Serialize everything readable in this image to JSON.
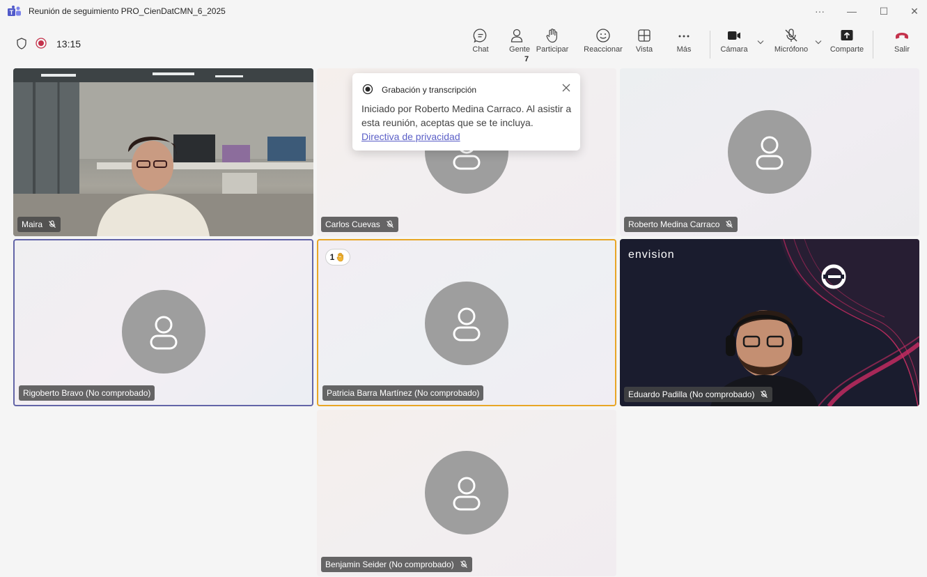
{
  "window": {
    "title": "Reunión de seguimiento PRO_CienDatCMN_6_2025",
    "more": "···",
    "minimize": "—",
    "maximize": "☐",
    "close": "✕"
  },
  "meeting": {
    "timer": "13:15"
  },
  "toolbar": {
    "chat": "Chat",
    "people": "Gente",
    "people_count": "7",
    "raise": "Participar",
    "react": "Reaccionar",
    "view": "Vista",
    "more": "Más",
    "camera": "Cámara",
    "mic": "Micrófono",
    "share": "Comparte",
    "leave": "Salir"
  },
  "popup": {
    "title": "Grabación y transcripción",
    "body": "Iniciado por Roberto Medina Carraco. Al asistir a esta reunión, aceptas que se te incluya.",
    "link": "Directiva de privacidad"
  },
  "tiles": {
    "maira": "Maira",
    "carlos": "Carlos Cuevas",
    "roberto": "Roberto Medina Carraco",
    "rigoberto": "Rigoberto Bravo (No comprobado)",
    "patricia": "Patricia Barra Martínez (No comprobado)",
    "patricia_hand_count": "1",
    "eduardo": "Eduardo Padilla (No comprobado)",
    "eduardo_bg_brand": "envision",
    "benjamin": "Benjamin Seider (No comprobado)"
  },
  "colors": {
    "accent": "#5b5fc7",
    "leave": "#c4314b",
    "record": "#c4314b",
    "active_speaker": "#6264a7",
    "raised_hand": "#e8a626"
  }
}
